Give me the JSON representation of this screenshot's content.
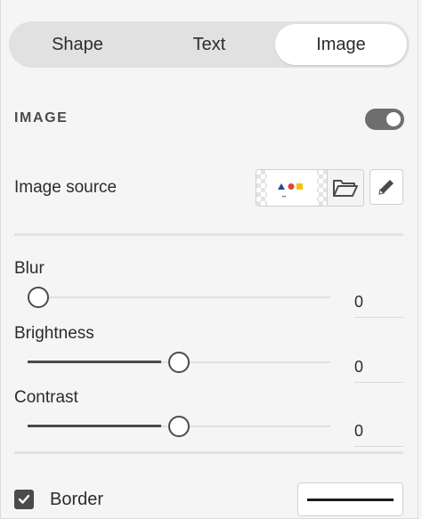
{
  "tabs": [
    {
      "label": "Shape",
      "active": false
    },
    {
      "label": "Text",
      "active": false
    },
    {
      "label": "Image",
      "active": true
    }
  ],
  "image_section": {
    "title": "IMAGE",
    "enabled": true
  },
  "image_source": {
    "label": "Image source",
    "folder_icon": "folder-open-icon",
    "edit_icon": "pencil-icon"
  },
  "adjustments": {
    "blur": {
      "label": "Blur",
      "value": "0",
      "level": 0.0
    },
    "brightness": {
      "label": "Brightness",
      "value": "0",
      "level": 0.5
    },
    "contrast": {
      "label": "Contrast",
      "value": "0",
      "level": 0.5
    }
  },
  "border": {
    "label": "Border",
    "checked": true,
    "stroke_color": "#1a1a1a"
  },
  "colors": {
    "accent": "#4b4b4b",
    "tab_track": "#e1e1e1",
    "panel_bg": "#f5f5f5"
  }
}
